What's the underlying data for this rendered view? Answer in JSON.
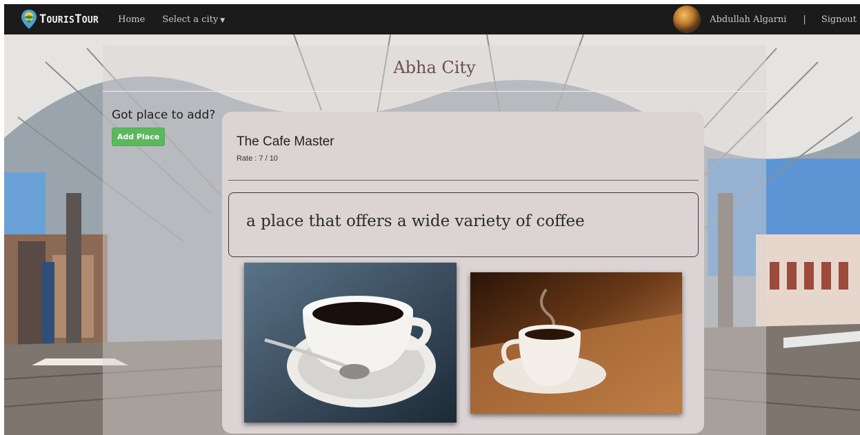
{
  "nav": {
    "brand": {
      "text_big": "T",
      "text_rest": "OURIS",
      "text_big2": "T",
      "text_rest2": "OUR",
      "logo_icon": "map-pin-globe-icon"
    },
    "links": [
      "Home",
      "Select a city"
    ],
    "user_name": "Abdullah Algarni",
    "separator": "|",
    "signout": "Signout"
  },
  "page": {
    "city_title": "Abha City",
    "add_prompt": "Got place to add?",
    "add_button": "Add Place"
  },
  "place": {
    "name": "The Cafe Master",
    "rate": "Rate : 7 / 10",
    "description": "a place that offers a wide variety of coffee"
  },
  "colors": {
    "navbar": "#1b1b1b",
    "add_button": "#5cb85c",
    "card": "#dcd4d4",
    "title": "#6b4e4e"
  }
}
